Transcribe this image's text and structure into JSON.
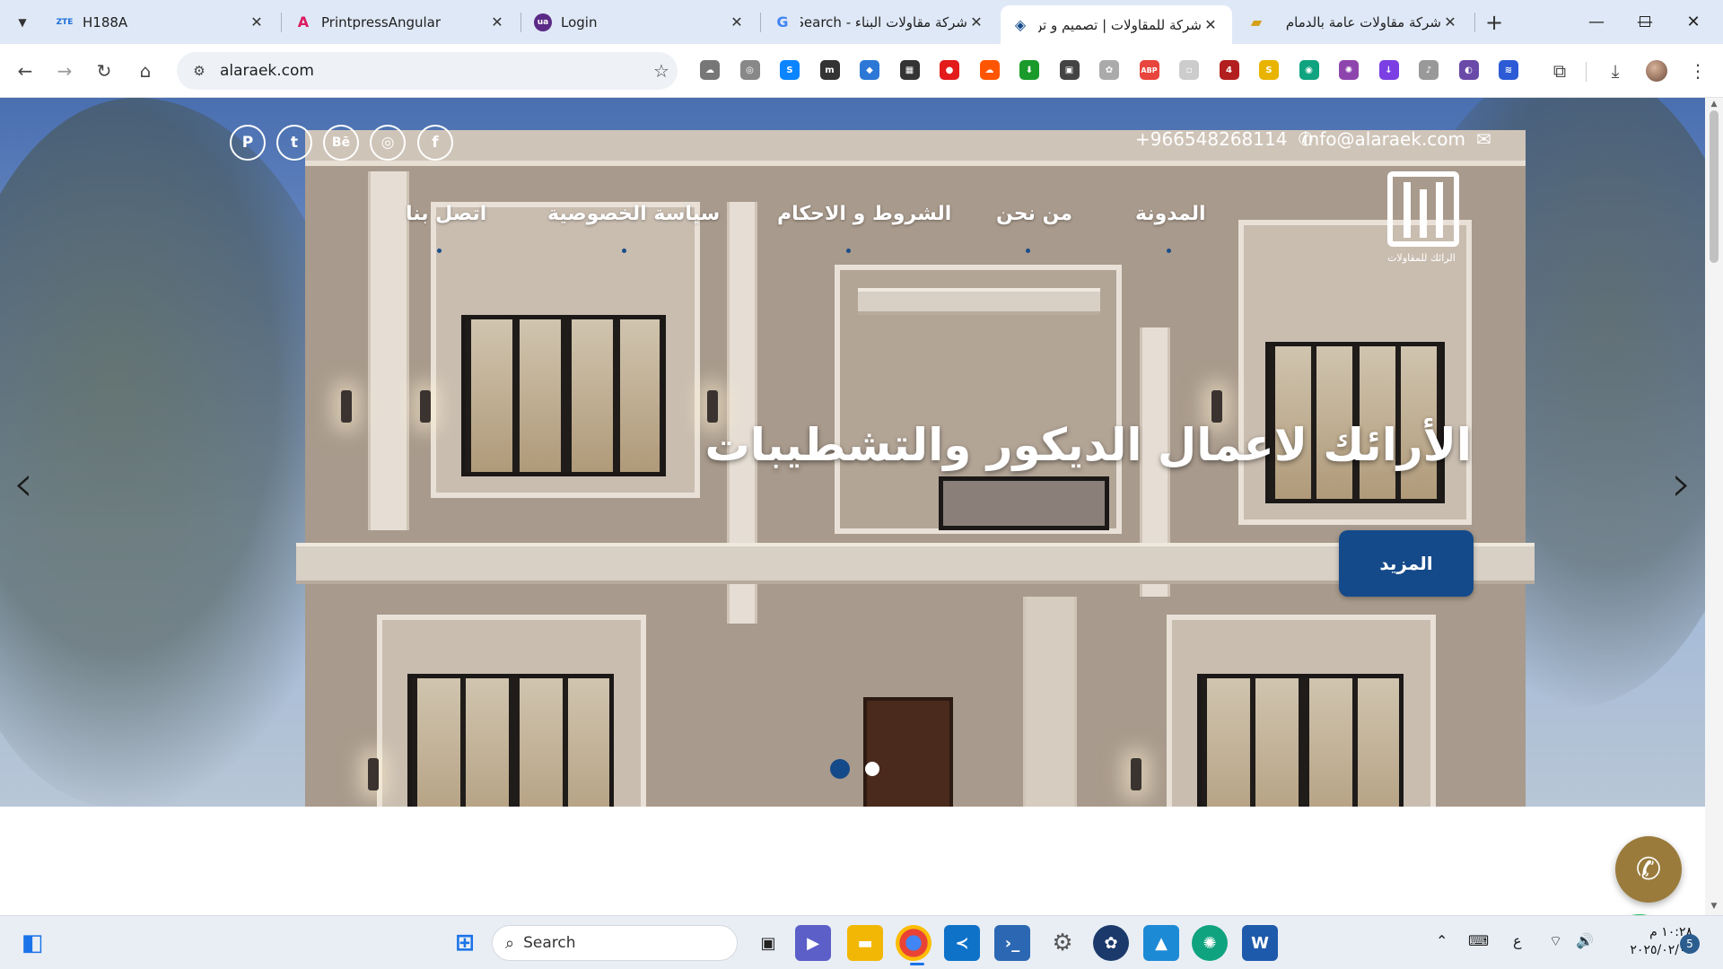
{
  "browser": {
    "tabs": [
      {
        "title": "H188A",
        "favicon": "ZTE",
        "favicon_color": "#1e6fd9"
      },
      {
        "title": "PrintpressAngular",
        "favicon": "A",
        "favicon_color": "#dd1b5f"
      },
      {
        "title": "Login",
        "favicon": "🎓",
        "favicon_color": "#5b2a86"
      },
      {
        "title": "شركة مقاولات البناء - Search",
        "favicon": "G",
        "favicon_color": "#4285f4"
      },
      {
        "title": "شركة للمقاولات | تصميم و تن",
        "favicon": "◈",
        "favicon_color": "#154a8a",
        "active": true
      },
      {
        "title": "شركة مقاولات عامة بالدمام",
        "favicon": "▰",
        "favicon_color": "#d4a017"
      }
    ],
    "url": "alaraek.com",
    "extensions": [
      {
        "name": "cloud-ext-icon",
        "glyph": "☁",
        "color": "#777"
      },
      {
        "name": "target-ext-icon",
        "glyph": "◎",
        "color": "#888"
      },
      {
        "name": "shazam-ext-icon",
        "glyph": "S",
        "color": "#0a84ff"
      },
      {
        "name": "m-ext-icon",
        "glyph": "m",
        "color": "#333"
      },
      {
        "name": "diamond-ext-icon",
        "glyph": "◆",
        "color": "#2d78d6"
      },
      {
        "name": "qr-ext-icon",
        "glyph": "▦",
        "color": "#333"
      },
      {
        "name": "stop-ext-icon",
        "glyph": "●",
        "color": "#e31b1b"
      },
      {
        "name": "soundcloud-ext-icon",
        "glyph": "☁",
        "color": "#ff5500"
      },
      {
        "name": "download-ext-icon",
        "glyph": "⬇",
        "color": "#1a9a2a"
      },
      {
        "name": "save-ext-icon",
        "glyph": "▣",
        "color": "#444"
      },
      {
        "name": "chatgpt-ext-icon",
        "glyph": "✿",
        "color": "#aaa"
      },
      {
        "name": "adblock-ext-icon",
        "glyph": "ABP",
        "color": "#e8453c"
      },
      {
        "name": "blank-ext-icon",
        "glyph": "▫",
        "color": "#ccc"
      },
      {
        "name": "shield-ext-icon",
        "glyph": "4",
        "color": "#b31e1e"
      },
      {
        "name": "s-ext-icon",
        "glyph": "S",
        "color": "#e8b400"
      },
      {
        "name": "gpt-ext-icon",
        "glyph": "◉",
        "color": "#10a37f"
      },
      {
        "name": "brain-ext-icon",
        "glyph": "✺",
        "color": "#8e44ad"
      },
      {
        "name": "arrow-down-ext-icon",
        "glyph": "↓",
        "color": "#7b3fe4"
      },
      {
        "name": "music-ext-icon",
        "glyph": "♪",
        "color": "#999"
      },
      {
        "name": "beaver-ext-icon",
        "glyph": "◐",
        "color": "#6a4aa8"
      },
      {
        "name": "translate-ext-icon",
        "glyph": "≋",
        "color": "#2d5bd6"
      }
    ]
  },
  "site": {
    "email": "info@alaraek.com",
    "phone": "+966548268114",
    "logo_caption": "الرائك للمقاولات",
    "nav": [
      "المدونة",
      "من نحن",
      "الشروط و الاحكام",
      "سياسة الخصوصية",
      "اتصل بنا"
    ],
    "social": [
      "P",
      "t",
      "Bē",
      "◎",
      "f"
    ],
    "headline": "الأرائك لاعمال الديكور والتشطيبات",
    "more_button": "المزيد",
    "active_dot_color": "#154a8a"
  },
  "taskbar": {
    "search_placeholder": "Search",
    "language": "ع",
    "time": "١٠:٢٨ م",
    "date": "٢٠٢٥/٠٢/٠٢",
    "notifications": "5"
  }
}
